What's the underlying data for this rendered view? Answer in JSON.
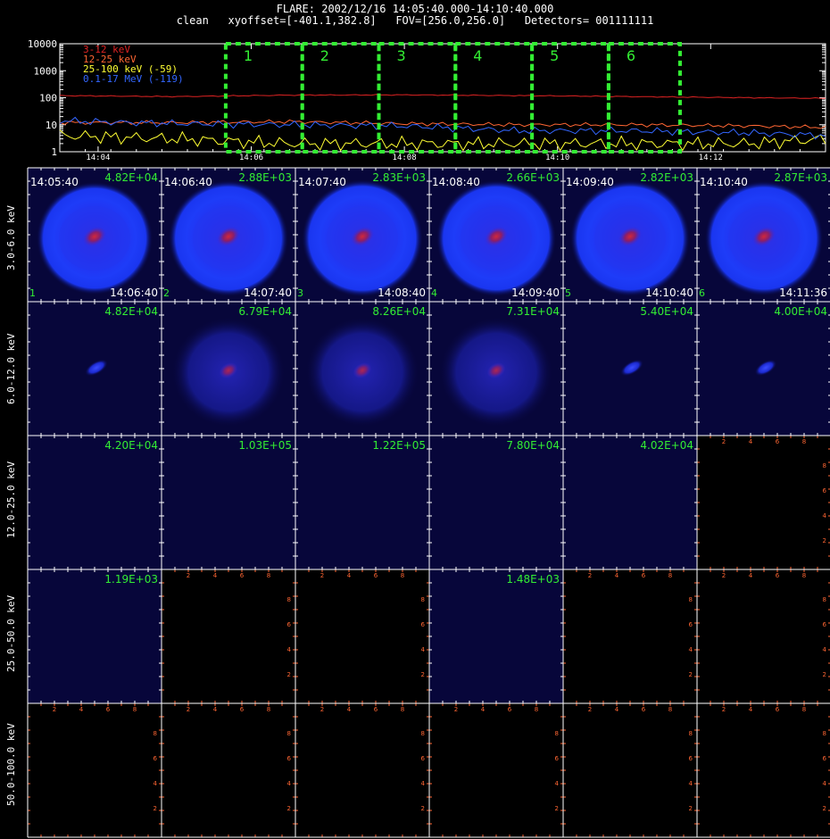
{
  "header": {
    "line1": "FLARE: 2002/12/16 14:05:40.000-14:10:40.000",
    "line2": "clean   xyoffset=[-401.1,382.8]   FOV=[256.0,256.0]   Detectors= 001111111"
  },
  "lightcurve": {
    "y_tick_labels": [
      "10000",
      "1000",
      "100",
      "10",
      "1"
    ],
    "x_tick_labels": [
      "14:04",
      "14:06",
      "14:08",
      "14:10",
      "14:12"
    ],
    "legend": [
      {
        "label": "3-12 keV",
        "color": "#dd2222"
      },
      {
        "label": "12-25 keV",
        "color": "#ff6633"
      },
      {
        "label": "25-100 keV (-59)",
        "color": "#ffff33"
      },
      {
        "label": "0.1-17 MeV (-119)",
        "color": "#3366ff"
      }
    ],
    "interval_labels": [
      "1",
      "2",
      "3",
      "4",
      "5",
      "6"
    ],
    "interval_color": "#33ee33"
  },
  "chart_data": {
    "type": "line",
    "title": "FLARE: 2002/12/16 14:05:40.000-14:10:40.000",
    "xlabel": "",
    "ylabel": "",
    "y_scale": "log",
    "ylim": [
      1,
      10000
    ],
    "x_range": [
      "14:03:30",
      "14:13:30"
    ],
    "x_ticks": [
      "14:04",
      "14:06",
      "14:08",
      "14:10",
      "14:12"
    ],
    "legend_position": "top-left",
    "series": [
      {
        "name": "3-12 keV",
        "color": "#dd2222",
        "x": [
          "14:03:30",
          "14:05:00",
          "14:06:30",
          "14:08:00",
          "14:09:30",
          "14:11:00",
          "14:12:30",
          "14:13:30"
        ],
        "values": [
          120,
          110,
          125,
          128,
          120,
          110,
          100,
          95
        ]
      },
      {
        "name": "12-25 keV",
        "color": "#ff6633",
        "x": [
          "14:03:30",
          "14:05:00",
          "14:06:30",
          "14:08:00",
          "14:09:30",
          "14:11:00",
          "14:12:30",
          "14:13:30"
        ],
        "values": [
          12,
          12,
          13,
          11,
          10,
          10,
          9,
          8
        ]
      },
      {
        "name": "25-100 keV (-59)",
        "color": "#ffff33",
        "x": [
          "14:03:30",
          "14:05:00",
          "14:06:30",
          "14:08:00",
          "14:09:30",
          "14:11:00",
          "14:12:30",
          "14:13:30"
        ],
        "values": [
          4,
          3,
          2,
          2,
          2,
          2,
          2,
          3
        ]
      },
      {
        "name": "0.1-17 MeV (-119)",
        "color": "#3366ff",
        "x": [
          "14:03:30",
          "14:05:00",
          "14:06:30",
          "14:08:00",
          "14:09:30",
          "14:11:00",
          "14:12:30",
          "14:13:30"
        ],
        "values": [
          14,
          11,
          10,
          9,
          6,
          6,
          5,
          4
        ]
      }
    ],
    "intervals": [
      {
        "label": "1",
        "start": "14:05:40",
        "end": "14:06:40"
      },
      {
        "label": "2",
        "start": "14:06:40",
        "end": "14:07:40"
      },
      {
        "label": "3",
        "start": "14:07:40",
        "end": "14:08:40"
      },
      {
        "label": "4",
        "start": "14:08:40",
        "end": "14:09:40"
      },
      {
        "label": "5",
        "start": "14:09:40",
        "end": "14:10:40"
      },
      {
        "label": "6",
        "start": "14:10:40",
        "end": "14:11:36"
      }
    ]
  },
  "image_grid": {
    "energy_bands": [
      "3.0-6.0 keV",
      "6.0-12.0 keV",
      "12.0-25.0 keV",
      "25.0-50.0 keV",
      "50.0-100.0 keV"
    ],
    "time_intervals": [
      {
        "index": "1",
        "start": "14:05:40",
        "end": "14:06:40"
      },
      {
        "index": "2",
        "start": "14:06:40",
        "end": "14:07:40"
      },
      {
        "index": "3",
        "start": "14:07:40",
        "end": "14:08:40"
      },
      {
        "index": "4",
        "start": "14:08:40",
        "end": "14:09:40"
      },
      {
        "index": "5",
        "start": "14:09:40",
        "end": "14:10:40"
      },
      {
        "index": "6",
        "start": "14:10:40",
        "end": "14:11:36"
      }
    ],
    "axis_tick_labels": [
      "2",
      "4",
      "6",
      "8"
    ],
    "cells": [
      [
        {
          "max": "4.82E+04",
          "kind": "ring",
          "intensity": 0.6
        },
        {
          "max": "2.88E+03",
          "kind": "ring",
          "intensity": 0.9
        },
        {
          "max": "2.83E+03",
          "kind": "ring",
          "intensity": 1.0
        },
        {
          "max": "2.66E+03",
          "kind": "ring",
          "intensity": 0.9
        },
        {
          "max": "2.82E+03",
          "kind": "ring",
          "intensity": 0.9
        },
        {
          "max": "2.87E+03",
          "kind": "ring",
          "intensity": 0.8
        }
      ],
      [
        {
          "max": "4.82E+04",
          "kind": "spot",
          "intensity": 0.4
        },
        {
          "max": "6.79E+04",
          "kind": "faint",
          "intensity": 0.4
        },
        {
          "max": "8.26E+04",
          "kind": "faint",
          "intensity": 0.5
        },
        {
          "max": "7.31E+04",
          "kind": "faint",
          "intensity": 0.4
        },
        {
          "max": "5.40E+04",
          "kind": "spot",
          "intensity": 0.4
        },
        {
          "max": "4.00E+04",
          "kind": "spot",
          "intensity": 0.3
        }
      ],
      [
        {
          "max": "4.20E+04",
          "kind": "blank",
          "intensity": 0
        },
        {
          "max": "1.03E+05",
          "kind": "blank",
          "intensity": 0
        },
        {
          "max": "1.22E+05",
          "kind": "blank",
          "intensity": 0
        },
        {
          "max": "7.80E+04",
          "kind": "blank",
          "intensity": 0
        },
        {
          "max": "4.02E+04",
          "kind": "blank",
          "intensity": 0
        },
        {
          "max": "",
          "kind": "empty",
          "intensity": 0
        }
      ],
      [
        {
          "max": "1.19E+03",
          "kind": "blank",
          "intensity": 0
        },
        {
          "max": "",
          "kind": "empty",
          "intensity": 0
        },
        {
          "max": "",
          "kind": "empty",
          "intensity": 0
        },
        {
          "max": "1.48E+03",
          "kind": "blank",
          "intensity": 0
        },
        {
          "max": "",
          "kind": "empty",
          "intensity": 0
        },
        {
          "max": "",
          "kind": "empty",
          "intensity": 0
        }
      ],
      [
        {
          "max": "",
          "kind": "empty",
          "intensity": 0
        },
        {
          "max": "",
          "kind": "empty",
          "intensity": 0
        },
        {
          "max": "",
          "kind": "empty",
          "intensity": 0
        },
        {
          "max": "",
          "kind": "empty",
          "intensity": 0
        },
        {
          "max": "",
          "kind": "empty",
          "intensity": 0
        },
        {
          "max": "",
          "kind": "empty",
          "intensity": 0
        }
      ]
    ]
  }
}
